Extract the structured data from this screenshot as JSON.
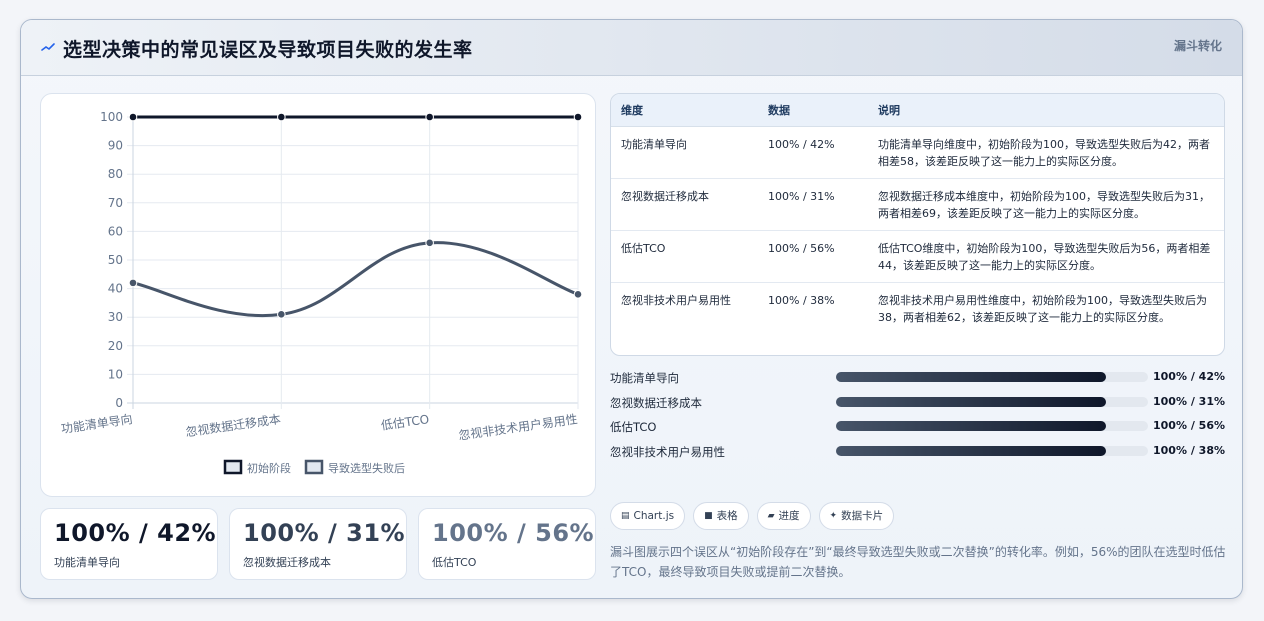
{
  "header": {
    "title": "选型决策中的常见误区及导致项目失败的发生率",
    "tag": "漏斗转化"
  },
  "chart_data": {
    "type": "line",
    "categories": [
      "功能清单导向",
      "忽视数据迁移成本",
      "低估TCO",
      "忽视非技术用户易用性"
    ],
    "series": [
      {
        "name": "初始阶段",
        "values": [
          100,
          100,
          100,
          100
        ],
        "color": "#0f172a"
      },
      {
        "name": "导致选型失败后",
        "values": [
          42,
          31,
          56,
          38
        ],
        "color": "#475569"
      }
    ],
    "ylim": [
      0,
      100
    ],
    "yticks": [
      0,
      10,
      20,
      30,
      40,
      50,
      60,
      70,
      80,
      90,
      100
    ],
    "grid": true,
    "legend": "bottom"
  },
  "kpis": [
    {
      "value": "100% / 42%",
      "label": "功能清单导向",
      "color": "#0f172a"
    },
    {
      "value": "100% / 31%",
      "label": "忽视数据迁移成本",
      "color": "#334155"
    },
    {
      "value": "100% / 56%",
      "label": "低估TCO",
      "color": "#64748b"
    }
  ],
  "table": {
    "headers": [
      "维度",
      "数据",
      "说明"
    ],
    "rows": [
      [
        "功能清单导向",
        "100% / 42%",
        "功能清单导向维度中，初始阶段为100，导致选型失败后为42，两者相差58，该差距反映了这一能力上的实际区分度。"
      ],
      [
        "忽视数据迁移成本",
        "100% / 31%",
        "忽视数据迁移成本维度中，初始阶段为100，导致选型失败后为31，两者相差69，该差距反映了这一能力上的实际区分度。"
      ],
      [
        "低估TCO",
        "100% / 56%",
        "低估TCO维度中，初始阶段为100，导致选型失败后为56，两者相差44，该差距反映了这一能力上的实际区分度。"
      ],
      [
        "忽视非技术用户易用性",
        "100% / 38%",
        "忽视非技术用户易用性维度中，初始阶段为100，导致选型失败后为38，两者相差62，该差距反映了这一能力上的实际区分度。"
      ]
    ]
  },
  "bars": [
    {
      "label": "功能清单导向",
      "value": "100% / 42%",
      "fill": 0.865
    },
    {
      "label": "忽视数据迁移成本",
      "value": "100% / 31%",
      "fill": 0.865
    },
    {
      "label": "低估TCO",
      "value": "100% / 56%",
      "fill": 0.865
    },
    {
      "label": "忽视非技术用户易用性",
      "value": "100% / 38%",
      "fill": 0.865
    }
  ],
  "chips": [
    {
      "icon": "chart-icon",
      "glyph": "▤",
      "label": "Chart.js"
    },
    {
      "icon": "table-icon",
      "glyph": "■",
      "label": "表格"
    },
    {
      "icon": "progress-icon",
      "glyph": "▰",
      "label": "进度"
    },
    {
      "icon": "card-icon",
      "glyph": "✦",
      "label": "数据卡片"
    }
  ],
  "description": "漏斗图展示四个误区从“初始阶段存在”到“最终导致选型失败或二次替换”的转化率。例如，56%的团队在选型时低估了TCO，最终导致项目失败或提前二次替换。"
}
